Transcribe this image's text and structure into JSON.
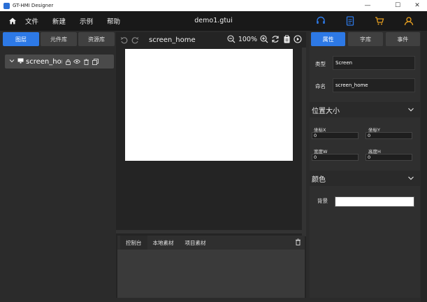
{
  "window": {
    "title": "GT-HMI Designer",
    "controls": {
      "minimize": "—",
      "maximize": "☐",
      "close": "✕"
    }
  },
  "menu": {
    "items": [
      "文件",
      "新建",
      "示例",
      "帮助"
    ],
    "doc_title": "demo1.gtui"
  },
  "left": {
    "tabs": [
      "图层",
      "元件库",
      "资源库"
    ],
    "tree_item": "screen_home"
  },
  "canvas": {
    "screen_name": "screen_home",
    "zoom": "100%"
  },
  "console": {
    "tabs": [
      "控制台",
      "本地素材",
      "项目素材"
    ]
  },
  "right": {
    "tabs": [
      "属性",
      "字库",
      "事件"
    ],
    "type_label": "类型",
    "type_value": "Screen",
    "name_label": "命名",
    "name_value": "screen_home",
    "section_pos": "位置大小",
    "x_label": "坐标X",
    "x_value": "0",
    "y_label": "坐标Y",
    "y_value": "0",
    "w_label": "宽度W",
    "w_value": "0",
    "h_label": "高度H",
    "h_value": "0",
    "section_color": "颜色",
    "bg_label": "背景",
    "bg_color": "#ffffff"
  },
  "colors": {
    "accent": "#2d79e6",
    "menu_icon": "#2d79e6",
    "cart_icon": "#e8a020"
  }
}
